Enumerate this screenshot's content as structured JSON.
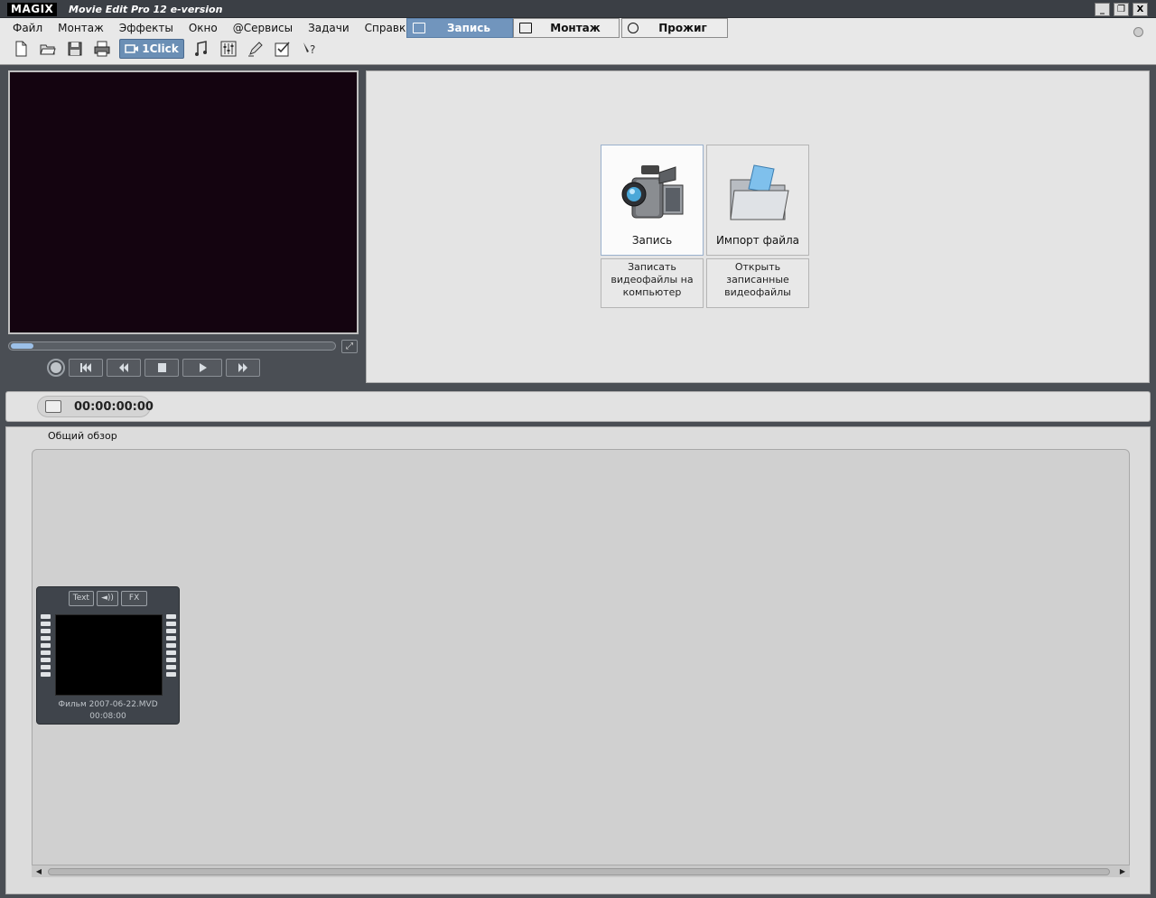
{
  "window": {
    "logo": "MAGIX",
    "title": "Movie Edit Pro 12 e-version",
    "controls": [
      "_",
      "❐",
      "X"
    ]
  },
  "menu": [
    "Файл",
    "Монтаж",
    "Эффекты",
    "Окно",
    "@Сервисы",
    "Задачи",
    "Справка"
  ],
  "toolbar": {
    "oneclick_label": "1Click",
    "icons": [
      "new-file-icon",
      "open-folder-icon",
      "save-icon",
      "print-icon",
      "audio-icon",
      "mixer-icon",
      "edit-pen-icon",
      "checklist-icon",
      "context-help-icon"
    ]
  },
  "mode_tabs": [
    {
      "label": "Запись",
      "active": true
    },
    {
      "label": "Монтаж",
      "active": false
    },
    {
      "label": "Прожиг",
      "active": false
    }
  ],
  "preview": {
    "position_fraction": 0.07,
    "transport": [
      "record-icon",
      "skip-start-icon",
      "rewind-icon",
      "stop-icon",
      "play-icon",
      "fast-forward-icon"
    ]
  },
  "actions": [
    {
      "label": "Запись",
      "description": "Записать видеофайлы на компьютер",
      "selected": true
    },
    {
      "label": "Импорт файла",
      "description": "Открыть записанные видеофайлы",
      "selected": false
    }
  ],
  "timecode": "00:00:00:00",
  "overview": {
    "label": "Общий обзор",
    "clip": {
      "buttons": [
        "Text",
        "◄))",
        "FX"
      ],
      "name": "Фильм 2007-06-22.MVD",
      "duration": "00:08:00"
    }
  },
  "colors": {
    "accent_tab": "#7195bd",
    "oneclick": "#6b8fb5",
    "monitor_bg": "#140410",
    "panel_dark": "#4a4e54"
  }
}
